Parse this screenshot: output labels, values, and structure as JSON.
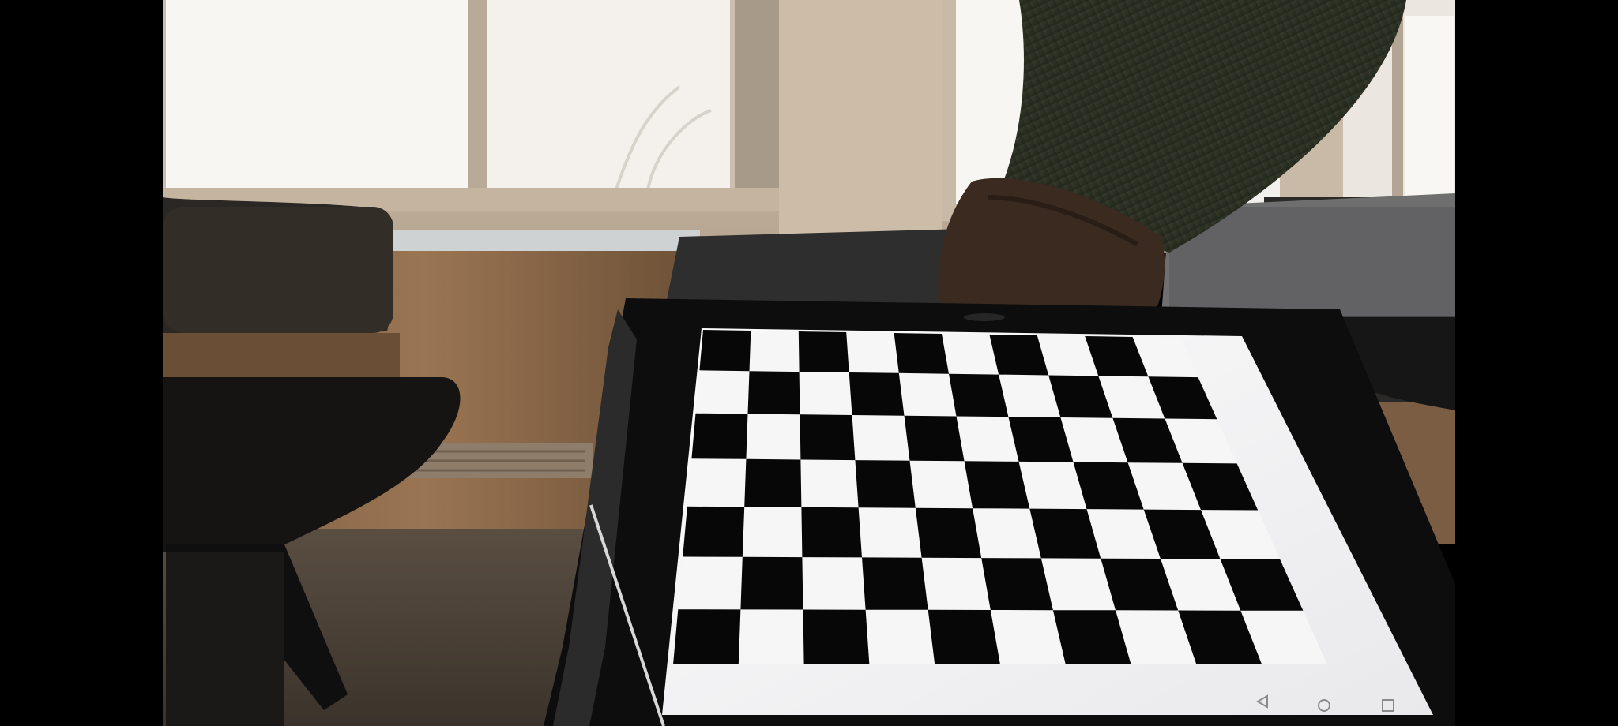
{
  "viewer": {
    "letterbox_color": "#000000"
  },
  "scene": {
    "description_icon": "photo-frame",
    "colors": {
      "window_light": "#f7f5f1",
      "wall_tan": "#c8b9a6",
      "wood_panel": "#8a6a48",
      "floor": "#4a4036",
      "desk_dark": "#1f1c19",
      "tablet_bezel": "#121212",
      "sleeve": "#2e3326",
      "skin": "#3a2a21"
    },
    "checkerboard": {
      "rows": 7,
      "cols": 10,
      "dark_color": "#070707",
      "light_color": "#f6f6f6"
    },
    "nav_bar": {
      "icons": [
        "back-triangle-icon",
        "home-circle-icon",
        "recents-square-icon"
      ]
    }
  }
}
